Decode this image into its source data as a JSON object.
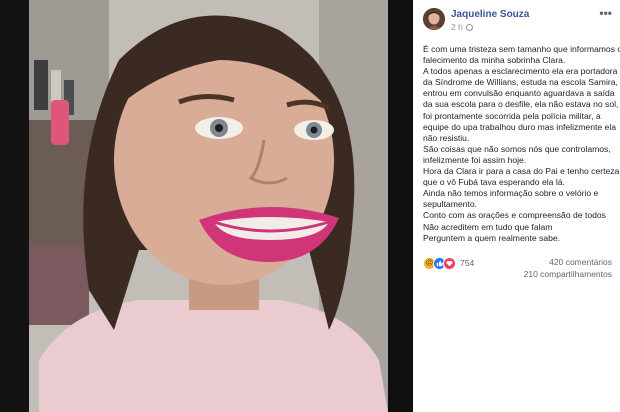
{
  "post": {
    "author": "Jaqueline Souza",
    "time": "2 h",
    "more": "•••",
    "text_lines": [
      "É com uma tristeza sem tamanho que informamos o",
      "falecimento da minha sobrinha Clara.",
      "A todos apenas a esclarecimento ela era portadora",
      "da Síndrome de Willians, estuda na escola Samira,",
      "entrou em convulsão enquanto aguardava a saída",
      "da sua escola para o desfile, ela não estava no sol,",
      "foi prontamente socorrida pela polícia militar, a",
      "equipe do upa trabalhou duro mas infelizmente ela",
      "não resistiu.",
      "São coisas que não somos nós que controlamos,",
      "infelizmente foi assim hoje.",
      "Hora da Clara ir para a casa do Pai e tenho certeza",
      "que o vô Fubá tava esperando ela lá.",
      "Ainda não temos informação sobre o velório e",
      "sepultamento.",
      "Conto com as orações e compreensão de todos",
      "Não acreditem em tudo que falam",
      "Perguntem a quem realmente sabe."
    ]
  },
  "reactions": {
    "icons": [
      "sad-emoji-icon",
      "like-icon",
      "love-icon"
    ],
    "count": "754",
    "colors": {
      "sad": "#f7b125",
      "like": "#2078f4",
      "love": "#f33e58"
    }
  },
  "stats": {
    "comments": "420 comentários",
    "shares": "210 compartilhamentos"
  },
  "colors": {
    "author_link": "#385898",
    "text": "#1d2129",
    "muted": "#90949c"
  }
}
